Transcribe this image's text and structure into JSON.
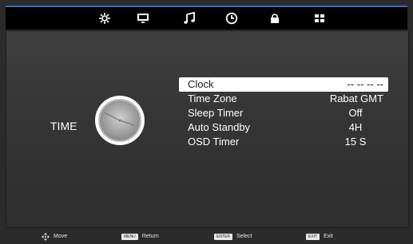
{
  "top_tabs": [
    {
      "icon": "picture-icon",
      "active": false
    },
    {
      "icon": "monitor-icon",
      "active": false
    },
    {
      "icon": "music-icon",
      "active": false
    },
    {
      "icon": "time-icon",
      "active": true
    },
    {
      "icon": "lock-icon",
      "active": false
    },
    {
      "icon": "setup-icon",
      "active": false
    }
  ],
  "page": {
    "title": "TIME"
  },
  "menu": {
    "items": [
      {
        "label": "Clock",
        "value": "-- -- -- --",
        "selected": true
      },
      {
        "label": "Time Zone",
        "value": "Rabat GMT",
        "selected": false
      },
      {
        "label": "Sleep Timer",
        "value": "Off",
        "selected": false
      },
      {
        "label": "Auto  Standby",
        "value": "4H",
        "selected": false
      },
      {
        "label": "OSD Timer",
        "value": "15 S",
        "selected": false
      }
    ]
  },
  "hints": {
    "move": "Move",
    "menu_key": "MENU",
    "return": "Return",
    "enter_key": "ENTER",
    "select": "Select",
    "exit_key": "EXIT",
    "exit": "Exit"
  },
  "colors": {
    "accent": "#2f6fc0",
    "selected_bg": "#ffffff",
    "panel": "#3a3a3a"
  }
}
